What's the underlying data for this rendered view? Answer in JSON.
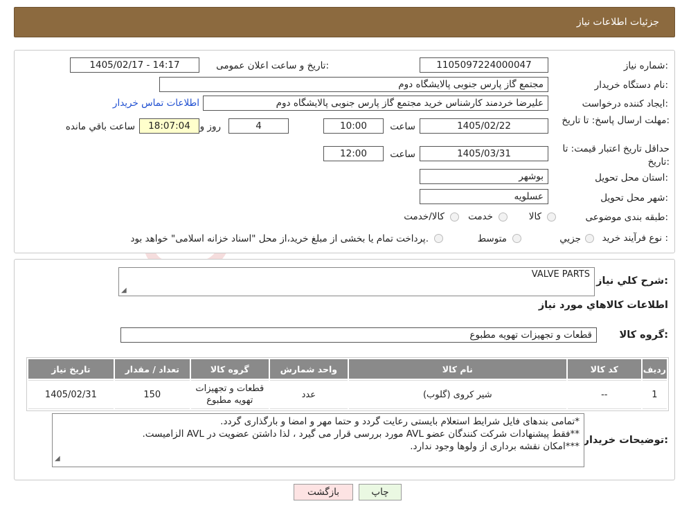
{
  "page_title": "جزئیات اطلاعات نیاز",
  "form": {
    "need_number_label": "شماره نیاز:",
    "need_number": "1105097224000047",
    "announce_label": "تاریخ و ساعت اعلان عمومی:",
    "announce_value": "1405/02/17 - 14:17",
    "buyer_org_label": "نام دستگاه خریدار:",
    "buyer_org": "مجتمع گاز پارس جنوبی  پالایشگاه دوم",
    "requester_label": "ایجاد کننده درخواست:",
    "requester": "علیرضا خردمند کارشناس خرید مجتمع گاز پارس جنوبی  پالایشگاه دوم",
    "buyer_contact_link": "اطلاعات تماس خریدار",
    "deadline_label": "مهلت ارسال پاسخ: تا تاریخ:",
    "deadline_date": "1405/02/22",
    "time_label": "ساعت",
    "deadline_time": "10:00",
    "days": "4",
    "days_label": "روز و",
    "remaining_time": "18:07:04",
    "remaining_label": "ساعت باقي مانده",
    "validity_label": "حداقل تاریخ اعتبار قیمت: تا تاریخ:",
    "validity_date": "1405/03/31",
    "validity_time": "12:00",
    "province_label": "استان محل تحویل:",
    "province": "بوشهر",
    "city_label": "شهر محل تحویل:",
    "city": "عسلویه",
    "category_label": "طبقه بندی موضوعی:",
    "category_options": [
      "کالا",
      "خدمت",
      "کالا/خدمت"
    ],
    "process_label": "نوع فرآیند خرید :",
    "process_options": [
      "جزیي",
      "متوسط"
    ],
    "process_note": "پرداخت تمام یا بخشی از مبلغ خرید،از محل \"اسناد خزانه اسلامی\" خواهد بود."
  },
  "summary": {
    "general_desc_label": "شرح کلي نياز:",
    "general_desc": "VALVE PARTS",
    "items_info_title": "اطلاعات کالاهاي مورد نياز",
    "goods_group_label": "گروه کالا:",
    "goods_group": "قطعات و تجهیزات تهویه مطبوع"
  },
  "table": {
    "headers": [
      "رديف",
      "کد کالا",
      "نام کالا",
      "واحد شمارش",
      "گروه کالا",
      "تعداد / مقدار",
      "تاریخ نیاز"
    ],
    "rows": [
      [
        "1",
        "--",
        "شیر کروی (گلوب)",
        "عدد",
        "قطعات و تجهیزات تهویه مطبوع",
        "150",
        "1405/02/31"
      ]
    ]
  },
  "buyer_notes": {
    "label": "توضیحات خریدار:",
    "lines": [
      "*تمامی بندهای فایل شرایط استعلام بایستی رعایت گردد و حتما مهر و امضا و بارگذاری گردد.",
      "**فقط پیشنهادات شرکت کنندگان عضو AVL مورد بررسی قرار می گیرد ، لذا داشتن عضویت در AVL الزامیست.",
      "***امکان نقشه برداری از ولوها وجود ندارد."
    ]
  },
  "buttons": {
    "print": "چاپ",
    "back": "بازگشت"
  },
  "colors": {
    "header": "#8c6a3f",
    "table_header": "#8a8a8a",
    "highlight": "#ffffcc",
    "link": "#1f4fd1",
    "print_bg": "#eaf8e2",
    "back_bg": "#fde3e3"
  },
  "icons": {
    "resize_grip": "resize-grip-icon",
    "radio": "radio-icon"
  }
}
